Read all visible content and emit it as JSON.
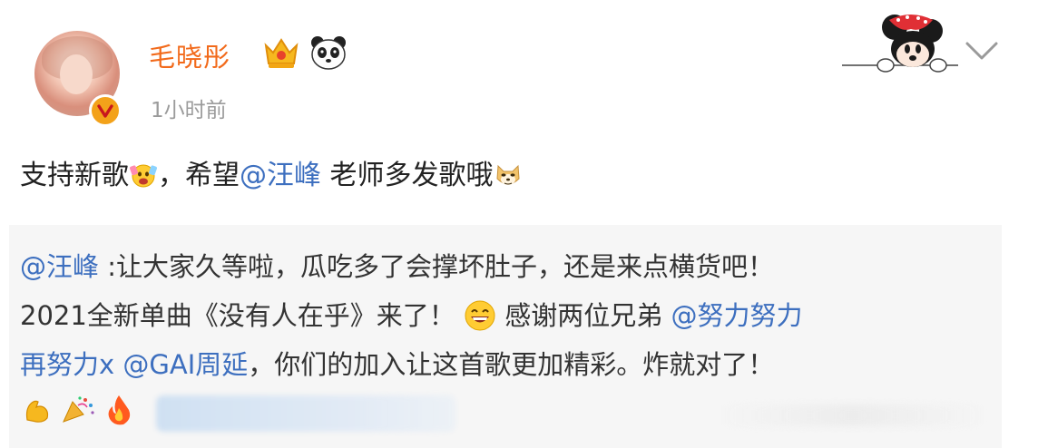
{
  "post": {
    "author": {
      "name": "毛晓彤",
      "badges": [
        "crown-icon",
        "panda-icon"
      ],
      "verified_icon": "verified-icon"
    },
    "timestamp": "1小时前",
    "text": {
      "part1": "支持新歌",
      "part2": "，希望",
      "mention": "@汪峰",
      "part3": " 老师多发歌哦"
    },
    "text_emojis": [
      "cheering-face-emoji",
      "doge-emoji"
    ],
    "repost": {
      "author_mention": "@汪峰",
      "line1_rest": " :让大家久等啦，瓜吃多了会撑坏肚子，还是来点横货吧！",
      "line2_text": "2021全新单曲《没有人在乎》来了！",
      "line2_after_emoji": "感谢两位兄弟 ",
      "line2_mention": "@努力努力",
      "line3_mention1": "再努力x",
      "line3_mention2": "@GAI周延",
      "line3_rest": "，你们的加入让这首歌更加精彩。炸就对了！",
      "emojis": [
        "muscle-emoji",
        "party-popper-emoji",
        "fire-emoji"
      ]
    }
  },
  "colors": {
    "username": "#f26a1b",
    "mention": "#3d6fbf",
    "timestamp": "#9b9b9b",
    "repost_bg": "#f6f6f6"
  }
}
